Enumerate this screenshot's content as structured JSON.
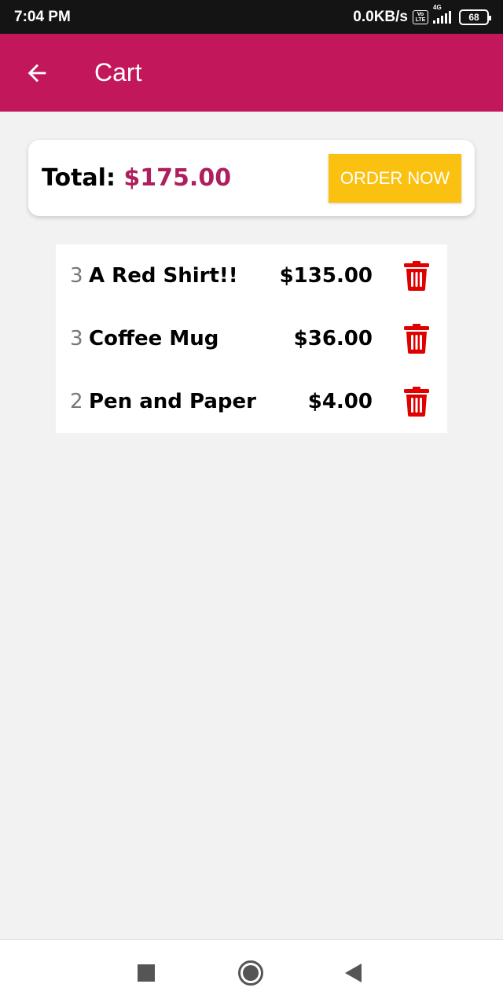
{
  "status_bar": {
    "time": "7:04 PM",
    "network_speed": "0.0KB/s",
    "volte_top": "Vo",
    "volte_bottom": "LTE",
    "network_type": "4G",
    "battery": "68",
    "icons": [
      "volte-icon",
      "signal-icon",
      "battery-icon"
    ]
  },
  "app_bar": {
    "title": "Cart",
    "background_color": "#c2185b",
    "back_icon": "arrow-left-icon"
  },
  "summary": {
    "total_label": "Total:",
    "total_value": "$175.00",
    "order_button_label": "ORDER NOW",
    "order_button_color": "#fbc111",
    "total_value_color": "#ad1f5e"
  },
  "cart_items": [
    {
      "quantity": "3",
      "name": "A Red Shirt!!",
      "price": "$135.00",
      "delete_icon": "trash-icon"
    },
    {
      "quantity": "3",
      "name": "Coffee Mug",
      "price": "$36.00",
      "delete_icon": "trash-icon"
    },
    {
      "quantity": "2",
      "name": "Pen and Paper",
      "price": "$4.00",
      "delete_icon": "trash-icon"
    }
  ],
  "delete_icon_color": "#e10000",
  "nav_bar": {
    "icons": [
      "recents-icon",
      "home-icon",
      "back-triangle-icon"
    ]
  }
}
